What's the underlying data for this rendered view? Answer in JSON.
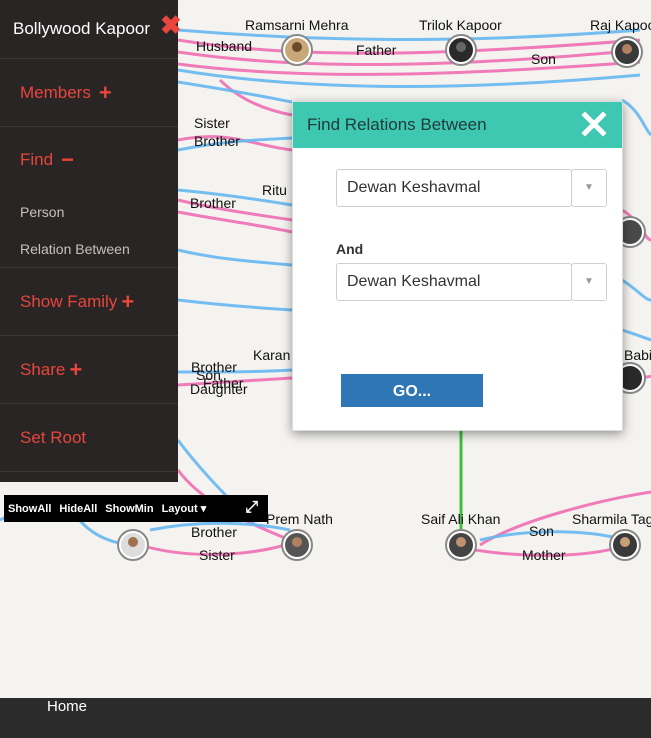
{
  "app": {
    "title": "Bollywood Kapoor"
  },
  "sidebar": {
    "members_label": "Members",
    "find_label": "Find",
    "find_items": [
      "Person",
      "Relation Between"
    ],
    "show_family_label": "Show Family",
    "share_label": "Share",
    "set_root_label": "Set Root"
  },
  "minibar": {
    "show_all": "ShowAll",
    "hide_all": "HideAll",
    "show_min": "ShowMin",
    "layout": "Layout"
  },
  "dialog": {
    "title": "Find Relations Between",
    "first_person": "Dewan Keshavmal",
    "and_label": "And",
    "second_person": "Dewan Keshavmal",
    "go_label": "GO..."
  },
  "graph": {
    "nodes": [
      "Ramsarni Mehra",
      "Trilok Kapoor",
      "Raj Kapoor",
      "Saif Ali Khan",
      "Sharmila Tagore",
      "Prem Nath",
      "Ritu",
      "Karan",
      "Babita"
    ],
    "edge_labels": [
      "Husband",
      "Father",
      "Son",
      "Sister",
      "Brother",
      "Daughter",
      "Mother"
    ]
  },
  "footer": {
    "home_label": "Home"
  },
  "colors": {
    "female_edge": "#f06fb4",
    "male_edge": "#67b8f2",
    "spouse_edge": "#3fbf3f",
    "accent": "#e8453c",
    "dialog_header": "#3ec8b2",
    "go_button": "#2f76b7"
  }
}
